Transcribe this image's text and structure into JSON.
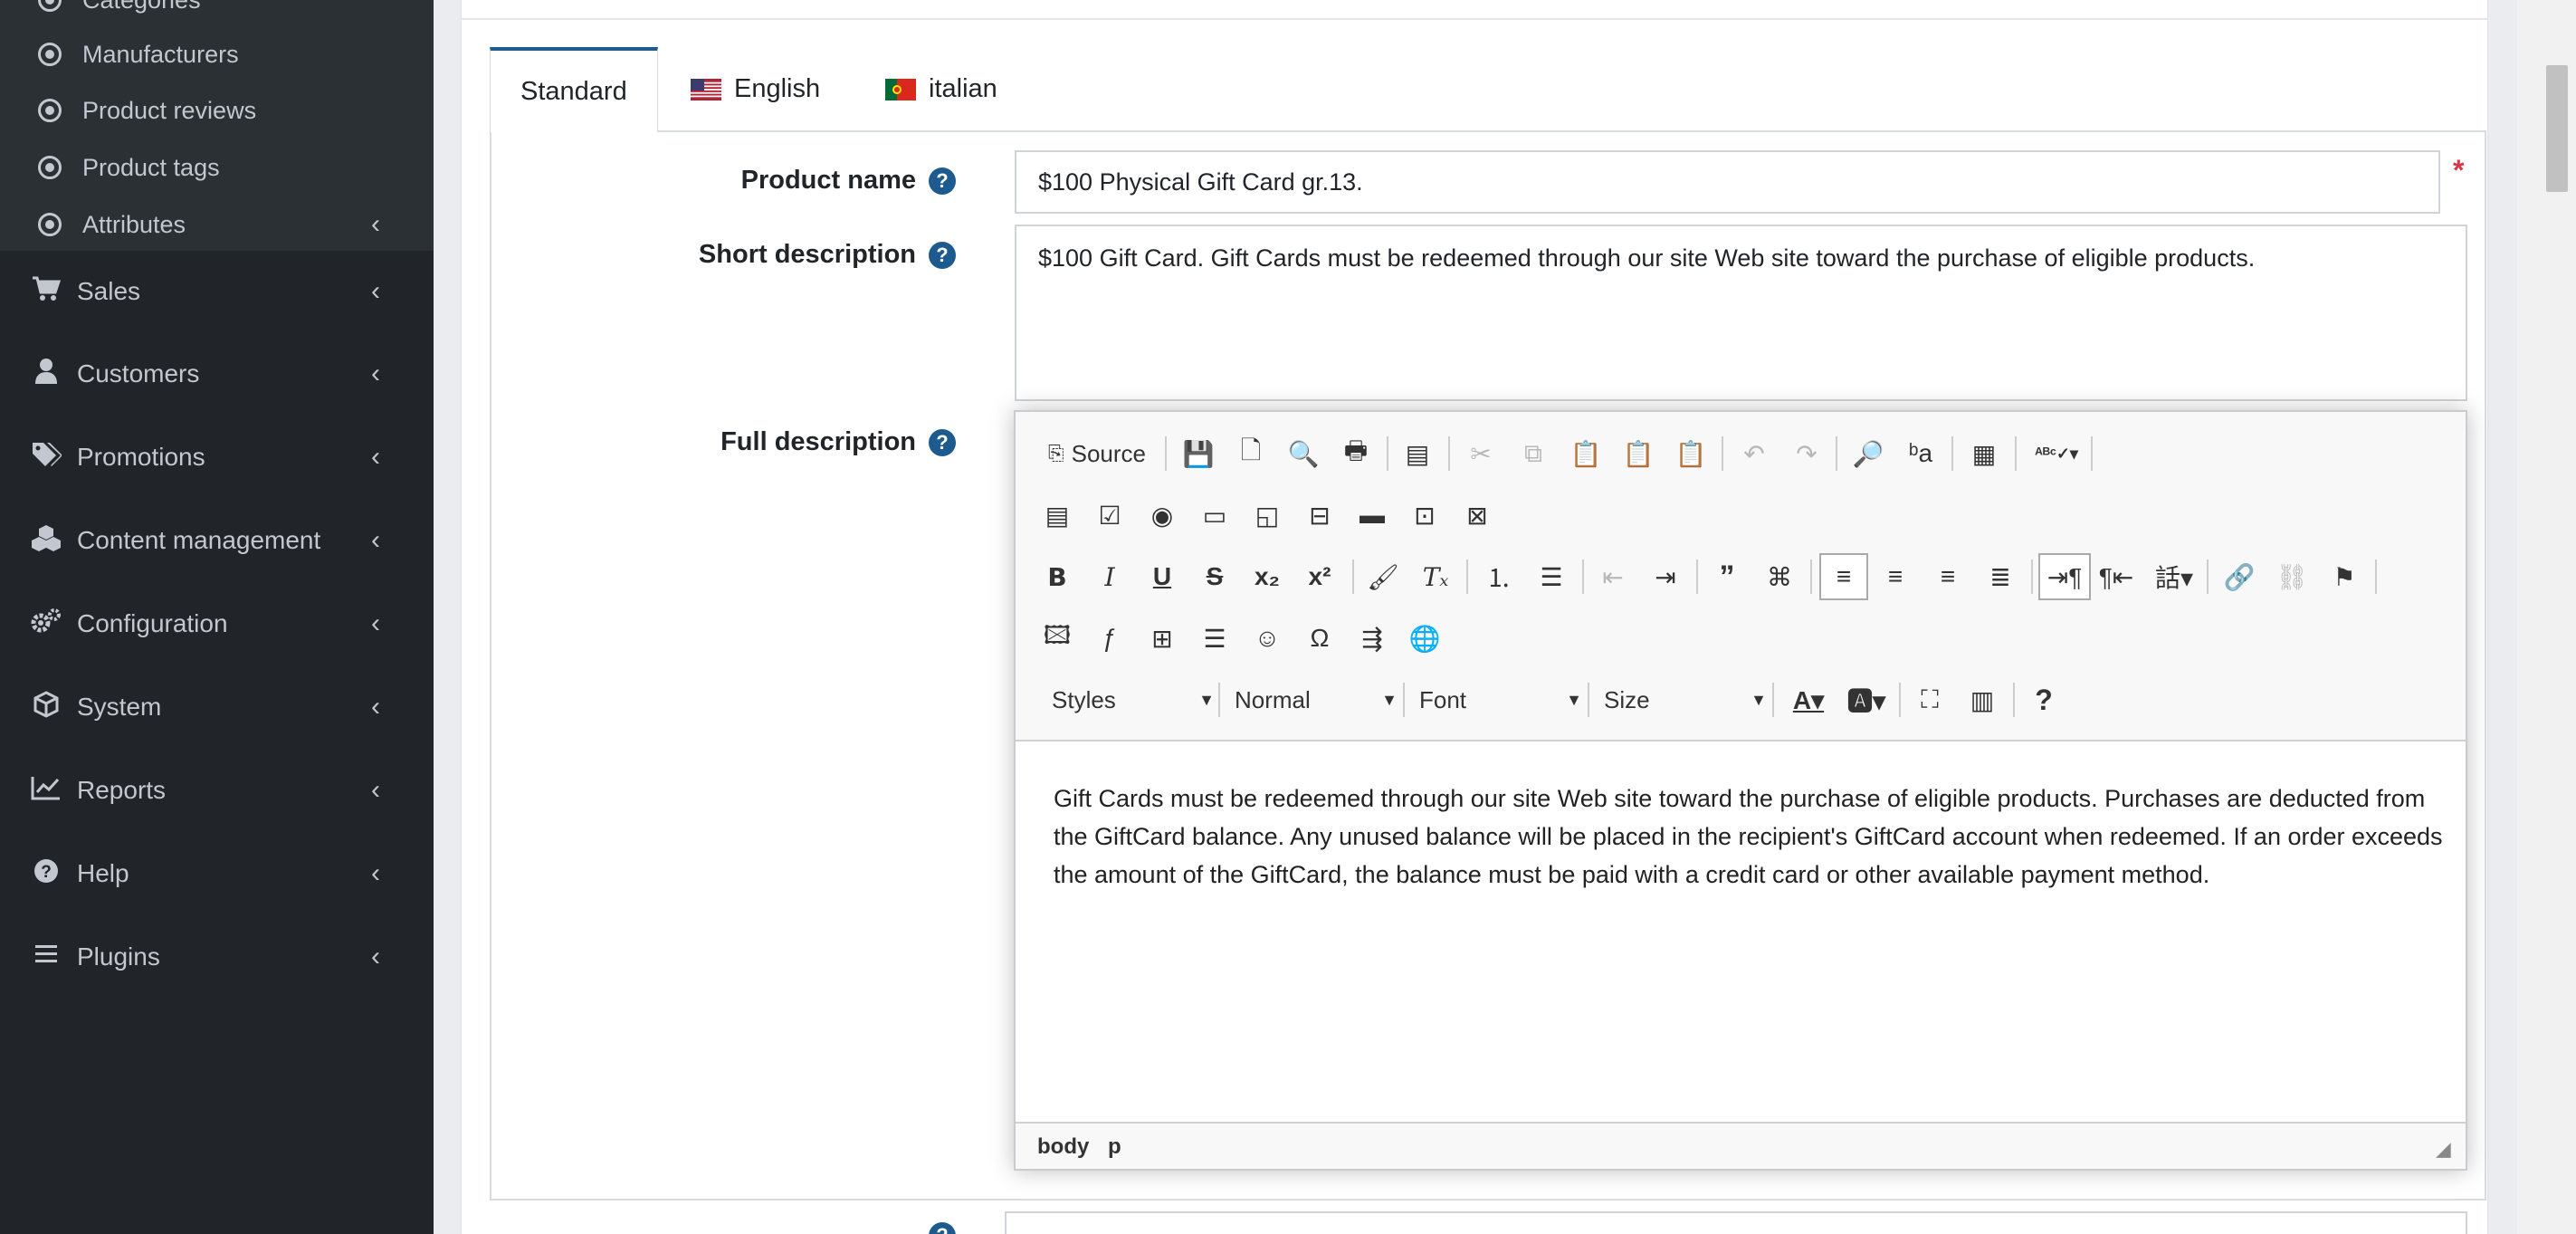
{
  "sidebar": {
    "sub_items": [
      {
        "label": "Categories"
      },
      {
        "label": "Manufacturers"
      },
      {
        "label": "Product reviews"
      },
      {
        "label": "Product tags"
      },
      {
        "label": "Attributes"
      }
    ],
    "nav_items": [
      {
        "label": "Sales",
        "icon": "cart-icon"
      },
      {
        "label": "Customers",
        "icon": "user-icon"
      },
      {
        "label": "Promotions",
        "icon": "tags-icon"
      },
      {
        "label": "Content management",
        "icon": "cubes-icon"
      },
      {
        "label": "Configuration",
        "icon": "gears-icon"
      },
      {
        "label": "System",
        "icon": "cube-icon"
      },
      {
        "label": "Reports",
        "icon": "line-chart-icon"
      },
      {
        "label": "Help",
        "icon": "question-circle-icon"
      },
      {
        "label": "Plugins",
        "icon": "bars-icon"
      }
    ]
  },
  "tabs": [
    {
      "label": "Standard",
      "active": true
    },
    {
      "label": "English",
      "flag": "us-flag-icon"
    },
    {
      "label": "italian",
      "flag": "pt-flag-icon"
    }
  ],
  "form": {
    "product_name_label": "Product name",
    "product_name_value": "$100 Physical Gift Card gr.13.",
    "required_mark": "*",
    "short_description_label": "Short description",
    "short_description_value": "$100 Gift Card. Gift Cards must be redeemed through our site Web site toward the purchase of eligible products.",
    "full_description_label": "Full description",
    "help_glyph": "?"
  },
  "editor": {
    "source_label": "Source",
    "styles_label": "Styles",
    "format_label": "Normal",
    "font_label": "Font",
    "size_label": "Size",
    "content": "Gift Cards must be redeemed through our site Web site toward the purchase of eligible products. Purchases are deducted from the GiftCard balance. Any unused balance will be placed in the recipient's GiftCard account when redeemed. If an order exceeds the amount of the GiftCard, the balance must be paid with a credit card or other available payment method.",
    "path": [
      "body",
      "p"
    ]
  },
  "colors": {
    "sidebar_bg": "#212529",
    "accent": "#1d5b8f",
    "required": "#dc3545"
  }
}
